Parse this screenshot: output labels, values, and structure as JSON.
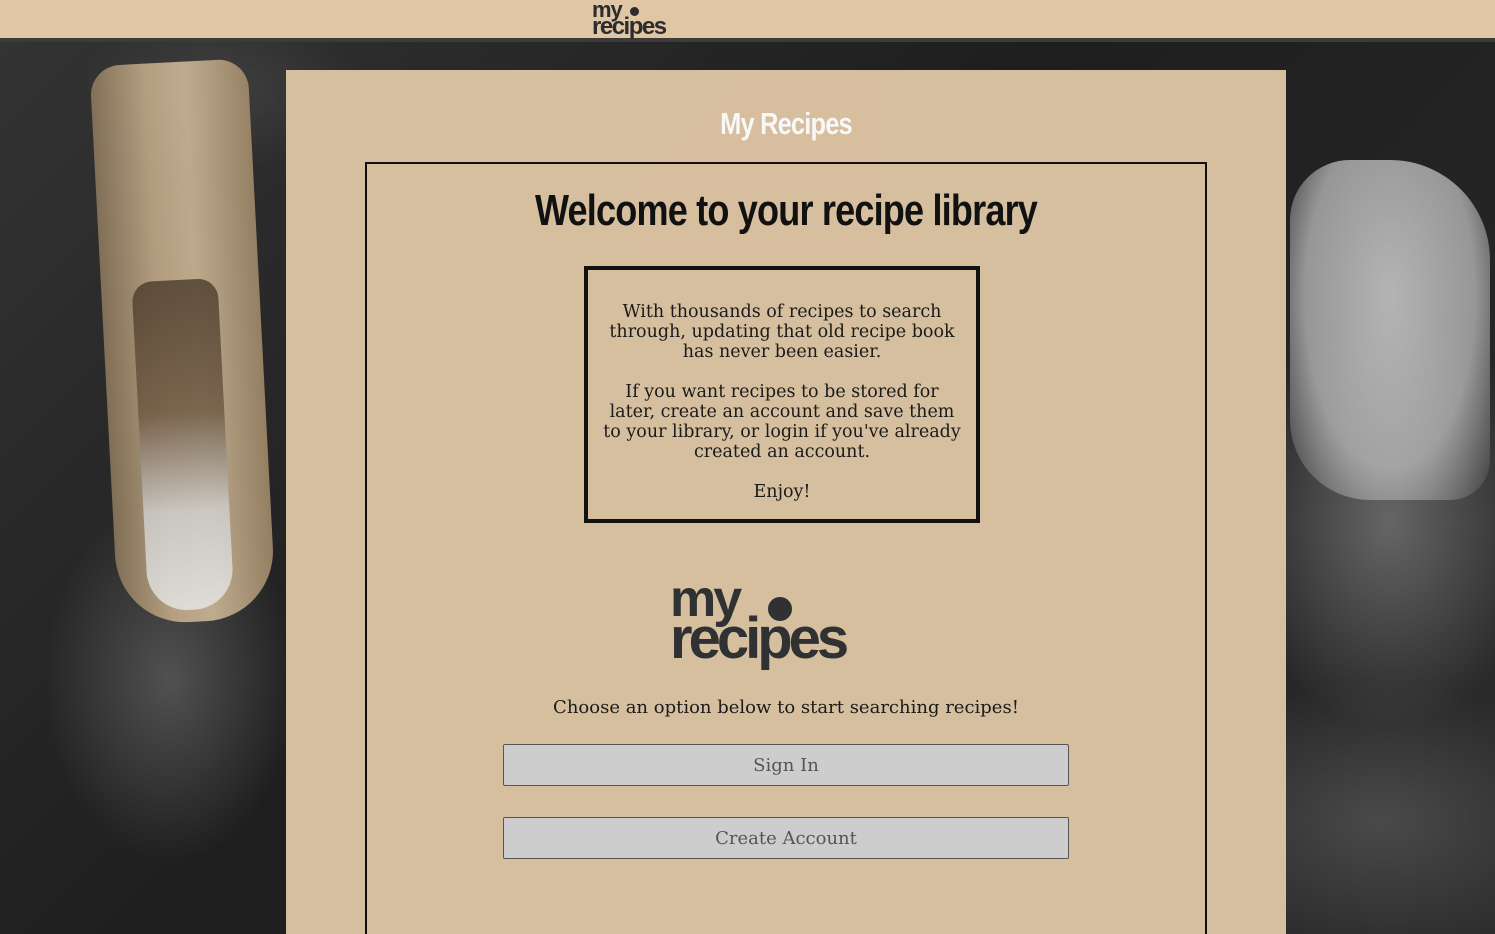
{
  "navbar": {
    "logo_line1": "my",
    "logo_line2": "recipes"
  },
  "panel": {
    "title": "My Recipes"
  },
  "card": {
    "heading": "Welcome to your recipe library",
    "intro": {
      "paragraph1": "With thousands of recipes to search through, updating that old recipe book has never been easier.",
      "paragraph2": "If you want recipes to be stored for later, create an account and save them to your library, or login if you've already created an account.",
      "paragraph3": "Enjoy!"
    },
    "logo_line1": "my",
    "logo_line2": "recipes",
    "choose_text": "Choose an option below to start searching recipes!",
    "buttons": {
      "sign_in": "Sign In",
      "create_account": "Create Account"
    }
  },
  "colors": {
    "navbar_bg": "#dfc6a5",
    "panel_bg": "#dcc4a3",
    "button_bg": "#cdcdcd",
    "text_dark": "#111111"
  }
}
